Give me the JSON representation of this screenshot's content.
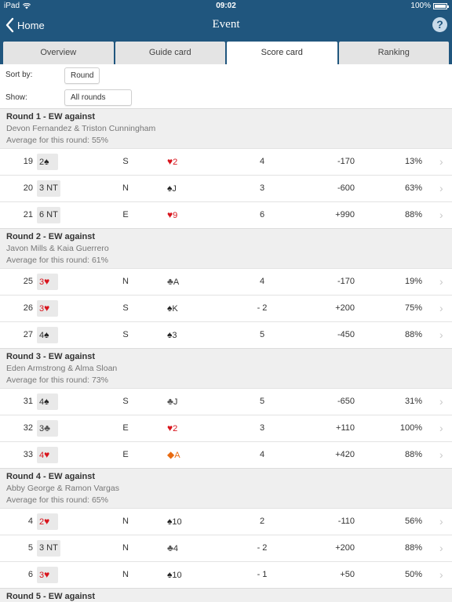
{
  "status": {
    "carrier": "iPad",
    "time": "09:02",
    "battery": "100%"
  },
  "nav": {
    "back_label": "Home",
    "title": "Event",
    "help": "?"
  },
  "tabs": [
    {
      "label": "Overview",
      "active": false
    },
    {
      "label": "Guide card",
      "active": false
    },
    {
      "label": "Score card",
      "active": true
    },
    {
      "label": "Ranking",
      "active": false
    }
  ],
  "controls": {
    "sort_label": "Sort by:",
    "sort_value": "Round",
    "show_label": "Show:",
    "show_value": "All rounds"
  },
  "colors": {
    "nav_bg": "#20567e",
    "red_suit": "#d8141c",
    "diamond": "#e86a10"
  },
  "rounds": [
    {
      "title": "Round  1 - EW  against",
      "players": "Devon Fernandez & Triston Cunningham",
      "average": "Average for this round:  55%",
      "boards": [
        {
          "board": "19",
          "level": "2",
          "suit": "♠",
          "suit_color": "black",
          "declarer": "S",
          "lead_suit": "♥",
          "lead_color": "red",
          "lead_card": "2",
          "tricks": "4",
          "score": "-170",
          "pct": "13%"
        },
        {
          "board": "20",
          "level": "3 NT",
          "suit": "",
          "suit_color": "black",
          "declarer": "N",
          "lead_suit": "♠",
          "lead_color": "black",
          "lead_card": "J",
          "tricks": "3",
          "score": "-600",
          "pct": "63%"
        },
        {
          "board": "21",
          "level": "6 NT",
          "suit": "",
          "suit_color": "black",
          "declarer": "E",
          "lead_suit": "♥",
          "lead_color": "red",
          "lead_card": "9",
          "tricks": "6",
          "score": "+990",
          "pct": "88%"
        }
      ]
    },
    {
      "title": "Round  2 - EW  against",
      "players": "Javon Mills & Kaia Guerrero",
      "average": "Average for this round:  61%",
      "boards": [
        {
          "board": "25",
          "level": "3",
          "suit": "♥",
          "suit_color": "red",
          "declarer": "N",
          "lead_suit": "♣",
          "lead_color": "club",
          "lead_card": "A",
          "tricks": "4",
          "score": "-170",
          "pct": "19%"
        },
        {
          "board": "26",
          "level": "3",
          "suit": "♥",
          "suit_color": "red",
          "declarer": "S",
          "lead_suit": "♠",
          "lead_color": "black",
          "lead_card": "K",
          "tricks": "- 2",
          "score": "+200",
          "pct": "75%"
        },
        {
          "board": "27",
          "level": "4",
          "suit": "♠",
          "suit_color": "black",
          "declarer": "S",
          "lead_suit": "♠",
          "lead_color": "black",
          "lead_card": "3",
          "tricks": "5",
          "score": "-450",
          "pct": "88%"
        }
      ]
    },
    {
      "title": "Round  3 - EW  against",
      "players": "Eden Armstrong & Alma Sloan",
      "average": "Average for this round:  73%",
      "boards": [
        {
          "board": "31",
          "level": "4",
          "suit": "♠",
          "suit_color": "black",
          "declarer": "S",
          "lead_suit": "♣",
          "lead_color": "club",
          "lead_card": "J",
          "tricks": "5",
          "score": "-650",
          "pct": "31%"
        },
        {
          "board": "32",
          "level": "3",
          "suit": "♣",
          "suit_color": "club",
          "declarer": "E",
          "lead_suit": "♥",
          "lead_color": "red",
          "lead_card": "2",
          "tricks": "3",
          "score": "+110",
          "pct": "100%"
        },
        {
          "board": "33",
          "level": "4",
          "suit": "♥",
          "suit_color": "red",
          "declarer": "E",
          "lead_suit": "◆",
          "lead_color": "orange",
          "lead_card": "A",
          "tricks": "4",
          "score": "+420",
          "pct": "88%"
        }
      ]
    },
    {
      "title": "Round  4 - EW  against",
      "players": "Abby George & Ramon Vargas",
      "average": "Average for this round:  65%",
      "boards": [
        {
          "board": "4",
          "level": "2",
          "suit": "♥",
          "suit_color": "red",
          "declarer": "N",
          "lead_suit": "♠",
          "lead_color": "black",
          "lead_card": "10",
          "tricks": "2",
          "score": "-110",
          "pct": "56%"
        },
        {
          "board": "5",
          "level": "3 NT",
          "suit": "",
          "suit_color": "black",
          "declarer": "N",
          "lead_suit": "♣",
          "lead_color": "club",
          "lead_card": "4",
          "tricks": "- 2",
          "score": "+200",
          "pct": "88%"
        },
        {
          "board": "6",
          "level": "3",
          "suit": "♥",
          "suit_color": "red",
          "declarer": "N",
          "lead_suit": "♠",
          "lead_color": "black",
          "lead_card": "10",
          "tricks": "- 1",
          "score": "+50",
          "pct": "50%"
        }
      ]
    },
    {
      "title": "Round  5 - EW  against",
      "players": "",
      "average": "",
      "boards": []
    }
  ]
}
